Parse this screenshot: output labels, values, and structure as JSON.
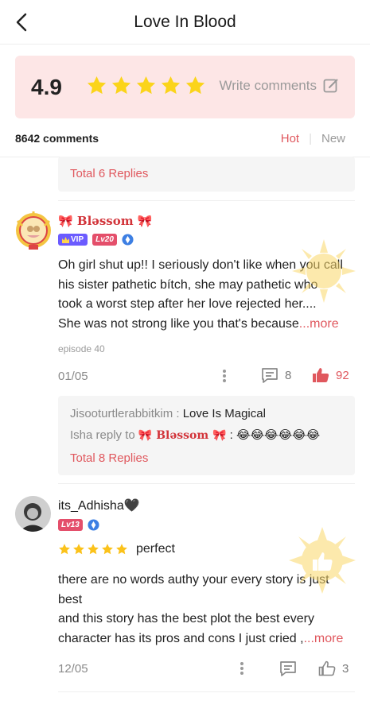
{
  "header": {
    "title": "Love In Blood"
  },
  "rating": {
    "score": "4.9",
    "star_count": 5,
    "write_label": "Write comments"
  },
  "comments_bar": {
    "count": "8642 comments",
    "sort_hot": "Hot",
    "sort_new": "New"
  },
  "top_reply_box": {
    "total_replies": "Total 6 Replies"
  },
  "comments": [
    {
      "username": "🎀 Bləssom 🎀",
      "badges": {
        "vip": "VIP",
        "level": "Lv20"
      },
      "text_lines": [
        "Oh girl shut up!! I seriously don't like when you call",
        "his sister pathetic bítch, she may pathetic who",
        "took a worst step after her love rejected her....",
        "She was not strong like you that's because"
      ],
      "more": "...more",
      "episode": "episode 40",
      "date": "01/05",
      "reply_count": "8",
      "like_count": "92",
      "replies": [
        {
          "author": "Jisooturtlerabbitkim : ",
          "text": "Love Is Magical"
        },
        {
          "author": "Isha reply to ",
          "mention": "🎀 Bləssom 🎀",
          "text": " : 😂😂😂😂😂😂"
        }
      ],
      "total_replies": "Total 8 Replies"
    },
    {
      "username": "its_Adhisha🖤",
      "badges": {
        "level": "Lv13"
      },
      "rating_stars": 5,
      "rating_tag": "perfect",
      "text_lines": [
        "there are no words authy your every story is just",
        "best",
        "and this story has the best plot the best every",
        "character has its pros and cons I just cried ,"
      ],
      "more": "...more",
      "date": "12/05",
      "like_count": "3"
    }
  ],
  "colors": {
    "accent": "#e0585e",
    "star": "#fbd41a",
    "card_bg": "#fde6e6"
  }
}
